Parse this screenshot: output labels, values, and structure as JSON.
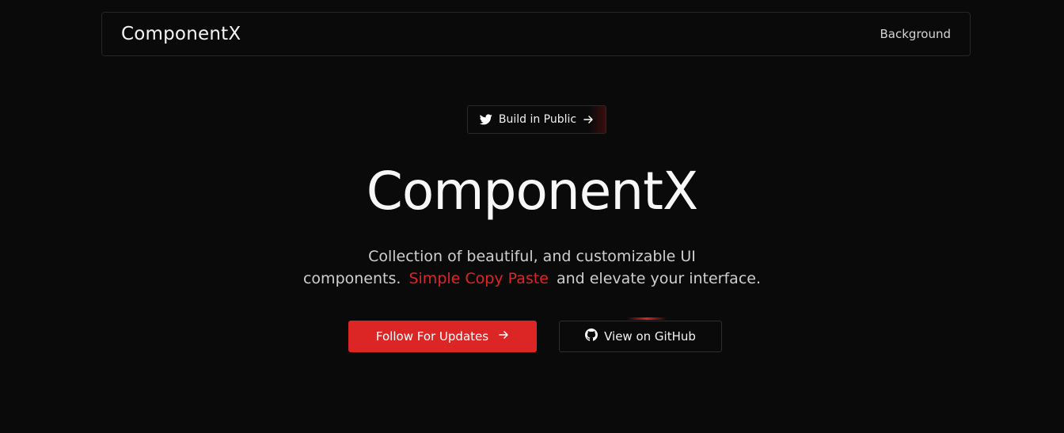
{
  "navbar": {
    "brand": "ComponentX",
    "link": "Background"
  },
  "badge": {
    "label": "Build in Public",
    "icon": "twitter-icon",
    "trailing_icon": "arrow-right-icon"
  },
  "hero": {
    "title": "ComponentX",
    "subtitle_line1": "Collection of beautiful, and customizable UI",
    "subtitle_line2_before": "components.",
    "subtitle_highlight": "Simple Copy Paste",
    "subtitle_line2_after": "and elevate your interface."
  },
  "actions": {
    "primary_label": "Follow For Updates",
    "primary_icon": "arrow-right-icon",
    "secondary_label": "View on GitHub",
    "secondary_icon": "github-icon"
  },
  "colors": {
    "background": "#0a0a0a",
    "accent": "#dc2626",
    "border": "#262626"
  }
}
